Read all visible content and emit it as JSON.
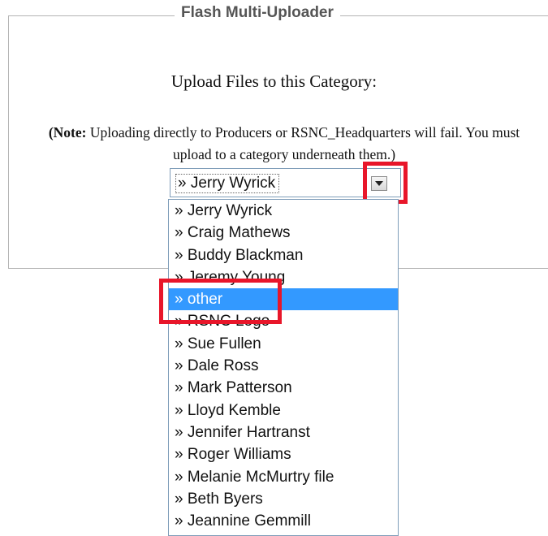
{
  "fieldset": {
    "legend": "Flash Multi-Uploader"
  },
  "upload": {
    "heading": "Upload Files to this Category:",
    "note_bold": "(Note:",
    "note_text": " Uploading directly to Producers or RSNC_Headquarters will fail. You must upload to a category underneath them.)"
  },
  "category_select": {
    "selected": "» Jerry Wyrick",
    "options": [
      "» Jerry Wyrick",
      "» Craig Mathews",
      "» Buddy Blackman",
      "» Jeremy Young",
      "» other",
      "» RSNC Logo",
      "» Sue Fullen",
      "» Dale Ross",
      "» Mark Patterson",
      "» Lloyd Kemble",
      "» Jennifer Hartranst",
      "» Roger Williams",
      "» Melanie McMurtry file",
      "» Beth Byers",
      "» Jeannine Gemmill"
    ],
    "highlighted_index": 4
  },
  "colors": {
    "highlight": "#3399ff",
    "annotation_red": "#e8162a",
    "legend_gray": "#555555"
  },
  "icons": {
    "dropdown_arrow": "chevron-down-icon"
  }
}
